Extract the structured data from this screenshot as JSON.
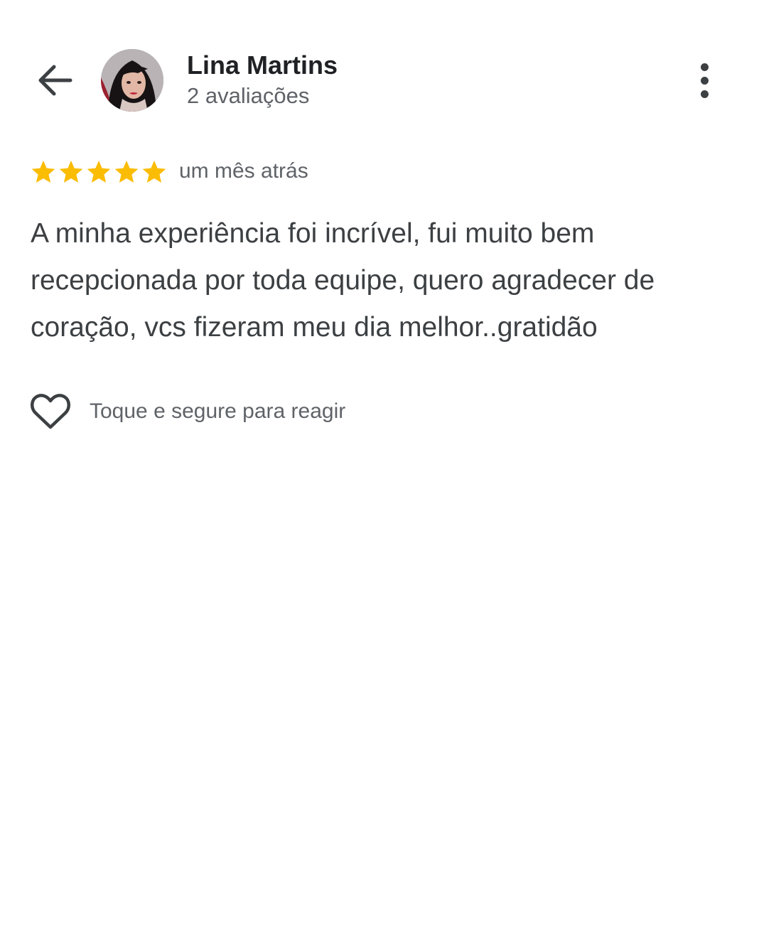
{
  "header": {
    "back_icon": "arrow-back-icon",
    "reviewer_name": "Lina Martins",
    "review_count": "2 avaliações",
    "more_icon": "more-vert-icon"
  },
  "review": {
    "rating": 5,
    "rating_max": 5,
    "star_color": "#fbbc04",
    "date": "um mês atrás",
    "text": "A minha experiência foi incrível, fui muito bem recepcionada por toda equipe, quero agradecer de coração, vcs fizeram meu dia melhor..gratidão"
  },
  "reaction": {
    "icon": "heart-outline-icon",
    "label": "Toque e segure para reagir"
  }
}
